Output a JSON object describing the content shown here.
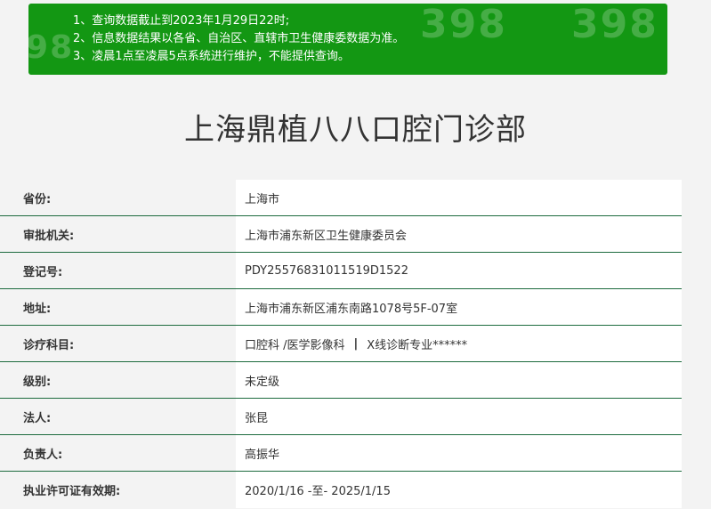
{
  "notice": {
    "lines": [
      "1、查询数据截止到2023年1月29日22时;",
      "2、信息数据结果以各省、自治区、直辖市卫生健康委数据为准。",
      "3、凌晨1点至凌晨5点系统进行维护，不能提供查询。"
    ],
    "watermark": "398",
    "background_color": "#139713"
  },
  "page_title": "上海鼎植八八口腔门诊部",
  "details": [
    {
      "label": "省份:",
      "value": "上海市"
    },
    {
      "label": "审批机关:",
      "value": "上海市浦东新区卫生健康委员会"
    },
    {
      "label": "登记号:",
      "value": "PDY25576831011519D1522"
    },
    {
      "label": "地址:",
      "value": "上海市浦东新区浦东南路1078号5F-07室"
    },
    {
      "label": "诊疗科目:",
      "value_parts": [
        "口腔科 /医学影像科",
        "|",
        "X线诊断专业******"
      ]
    },
    {
      "label": "级别:",
      "value": "未定级"
    },
    {
      "label": "法人:",
      "value": "张昆"
    },
    {
      "label": "负责人:",
      "value": "高振华"
    },
    {
      "label": "执业许可证有效期:",
      "value": "2020/1/16 -至- 2025/1/15"
    }
  ]
}
